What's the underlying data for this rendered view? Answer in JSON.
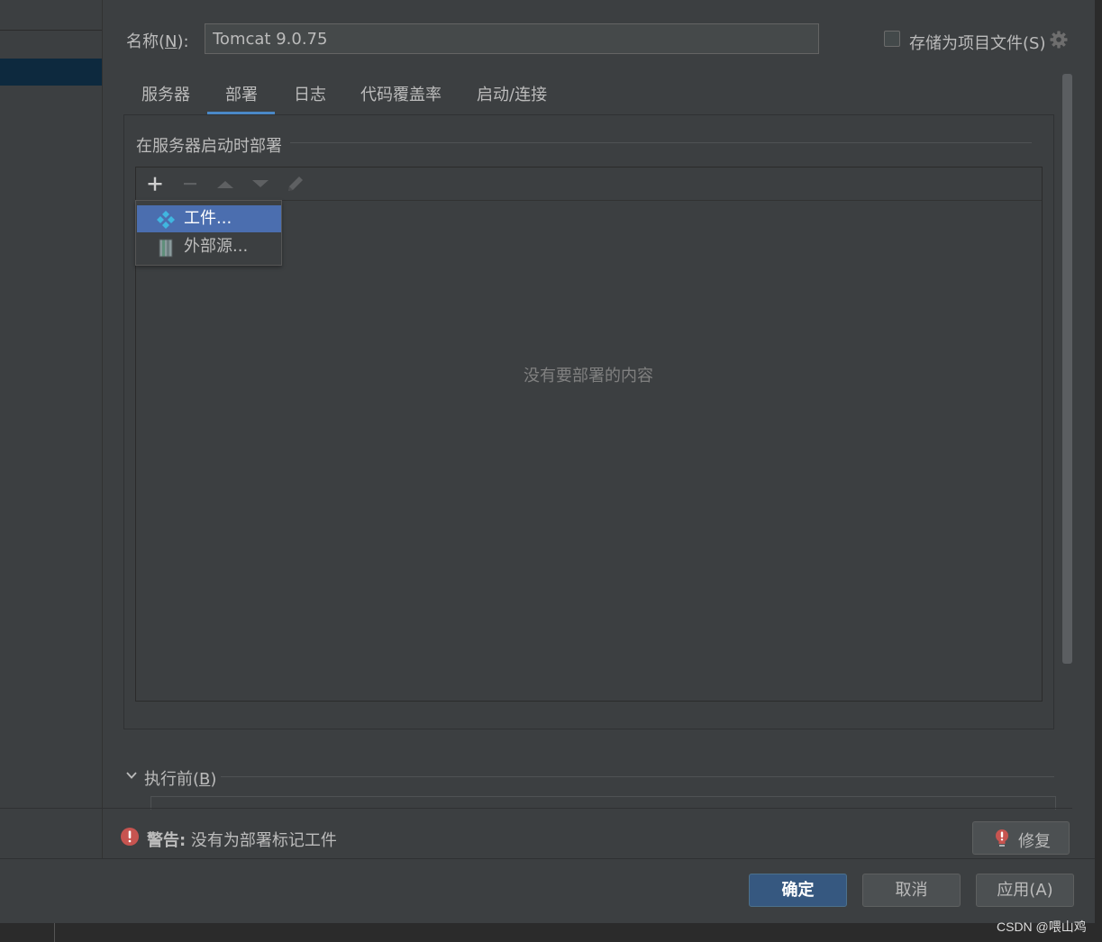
{
  "header": {
    "name_label_prefix": "名称(",
    "name_label_mnemonic": "N",
    "name_label_suffix": "):",
    "name_value": "Tomcat 9.0.75",
    "store_as_project_file_label": "存储为项目文件(S)",
    "store_as_project_file_checked": false
  },
  "tabs": [
    {
      "label": "服务器",
      "active": false
    },
    {
      "label": "部署",
      "active": true
    },
    {
      "label": "日志",
      "active": false
    },
    {
      "label": "代码覆盖率",
      "active": false
    },
    {
      "label": "启动/连接",
      "active": false
    }
  ],
  "deployment": {
    "section_title": "在服务器启动时部署",
    "empty_text": "没有要部署的内容",
    "toolbar": [
      "add-icon",
      "remove-icon",
      "move-up-icon",
      "move-down-icon",
      "edit-icon"
    ]
  },
  "add_popup": {
    "items": [
      {
        "label": "工件...",
        "icon": "artifact-icon",
        "highlighted": true
      },
      {
        "label": "外部源...",
        "icon": "external-source-icon",
        "highlighted": false
      }
    ]
  },
  "before_launch": {
    "label_prefix": "执行前(",
    "label_mnemonic": "B",
    "label_suffix": ")"
  },
  "warning": {
    "label": "警告:",
    "message": " 没有为部署标记工件",
    "fix_button": "修复"
  },
  "footer": {
    "ok": "确定",
    "cancel": "取消",
    "apply": "应用(A)"
  },
  "watermark": "CSDN @喂山鸡",
  "colors": {
    "background": "#3c3f41",
    "accent": "#4a88c7",
    "highlight": "#4b6eaf",
    "primary_button": "#365880",
    "warning": "#c75450"
  }
}
